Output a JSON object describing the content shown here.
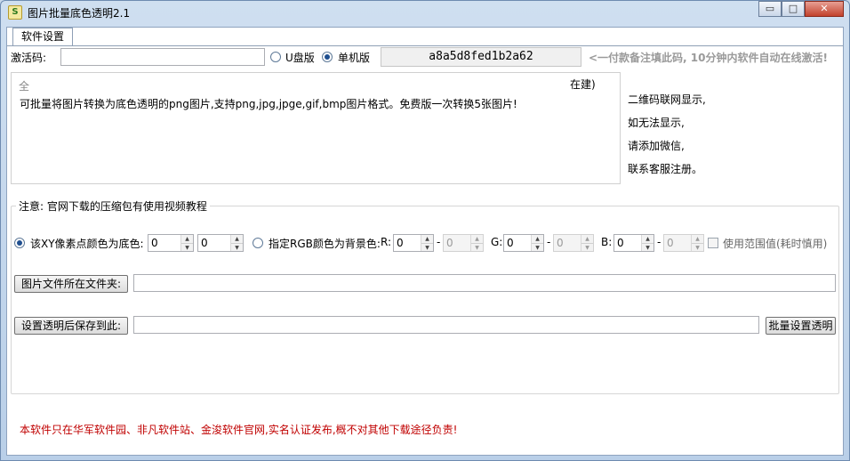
{
  "window": {
    "title": "图片批量底色透明2.1",
    "icon_name": "app-icon",
    "controls": {
      "minimize": "▭",
      "maximize": "□",
      "close": "✕"
    }
  },
  "tabs": [
    {
      "label": "软件设置"
    }
  ],
  "activation": {
    "label": "激活码:",
    "input_value": "",
    "option_udisk": "U盘版",
    "option_single": "单机版",
    "code": "a8a5d8fed1b2a62",
    "hint": "<一付款备注填此码, 10分钟内软件自动在线激活!"
  },
  "description": {
    "partial_left": "全",
    "partial_right": "在建)",
    "text": "可批量将图片转换为底色透明的png图片,支持png,jpg,jpge,gif,bmp图片格式。免费版一次转换5张图片!"
  },
  "side_notes": [
    "二维码联网显示,",
    "如无法显示,",
    "请添加微信,",
    "联系客服注册。"
  ],
  "notice": {
    "title": "注意: 官网下载的压缩包有使用视频教程"
  },
  "color_options": {
    "xy_label": "该XY像素点颜色为底色:",
    "x_value": "0",
    "y_value": "0",
    "rgb_label": "指定RGB颜色为背景色:",
    "r_label": "R:",
    "g_label": "G:",
    "b_label": "B:",
    "dash": "-",
    "r_from": "0",
    "r_to": "0",
    "g_from": "0",
    "g_to": "0",
    "b_from": "0",
    "b_to": "0",
    "range_label": "使用范围值(耗时慎用)"
  },
  "folder": {
    "button": "图片文件所在文件夹:",
    "value": ""
  },
  "save": {
    "button": "设置透明后保存到此:",
    "value": "",
    "batch_button": "批量设置透明"
  },
  "footer": {
    "text": "本软件只在华军软件园、非凡软件站、金浚软件官网,实名认证发布,概不对其他下载途径负责!"
  },
  "colors": {
    "footer_red": "#c00000",
    "hint_grey": "#9a9a9a"
  }
}
